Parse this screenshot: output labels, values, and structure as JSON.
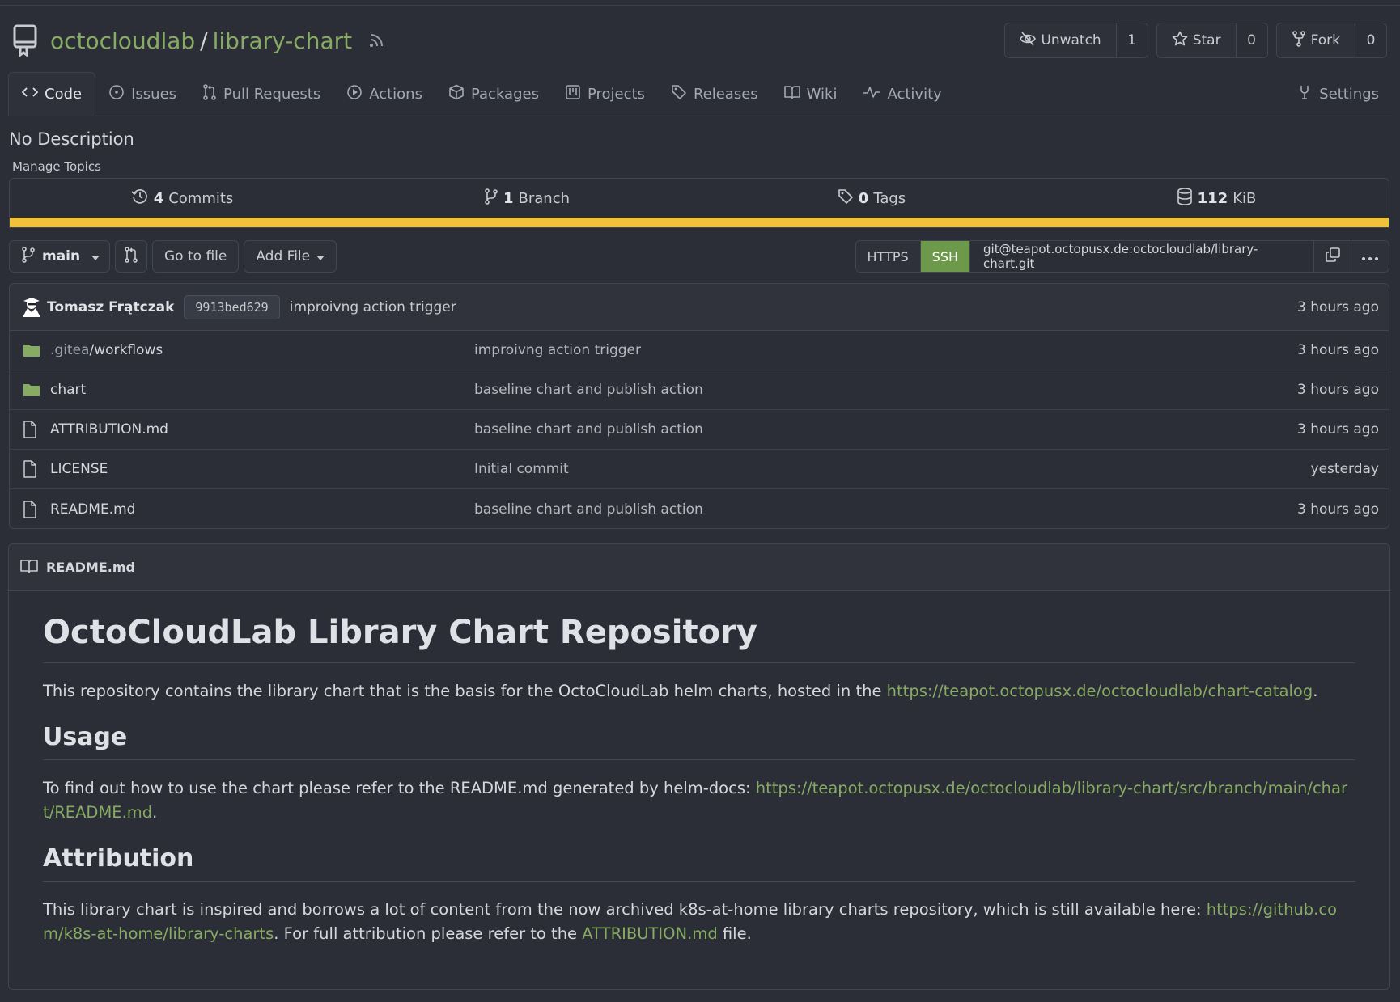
{
  "repo": {
    "owner": "octocloudlab",
    "separator": "/",
    "name": "library-chart",
    "unwatch_label": "Unwatch",
    "watch_count": "1",
    "star_label": "Star",
    "star_count": "0",
    "fork_label": "Fork",
    "fork_count": "0"
  },
  "tabs": [
    {
      "label": "Code",
      "icon": "code-icon",
      "active": true
    },
    {
      "label": "Issues",
      "icon": "issue-icon"
    },
    {
      "label": "Pull Requests",
      "icon": "pull-request-icon"
    },
    {
      "label": "Actions",
      "icon": "play-icon"
    },
    {
      "label": "Packages",
      "icon": "package-icon"
    },
    {
      "label": "Projects",
      "icon": "project-icon"
    },
    {
      "label": "Releases",
      "icon": "tag-icon"
    },
    {
      "label": "Wiki",
      "icon": "book-icon"
    },
    {
      "label": "Activity",
      "icon": "pulse-icon"
    },
    {
      "label": "Settings",
      "icon": "tools-icon"
    }
  ],
  "description": "No Description",
  "manage_topics": "Manage Topics",
  "stats": {
    "commits_count": "4",
    "commits_label": "Commits",
    "branch_count": "1",
    "branch_label": "Branch",
    "tags_count": "0",
    "tags_label": "Tags",
    "size_value": "112",
    "size_unit": "KiB"
  },
  "language_bar_color": "#f0c23a",
  "toolbar": {
    "branch": "main",
    "go_to_file": "Go to file",
    "add_file": "Add File",
    "https_label": "HTTPS",
    "ssh_label": "SSH",
    "clone_url": "git@teapot.octopusx.de:octocloudlab/library-chart.git"
  },
  "latest_commit": {
    "author": "Tomasz Frątczak",
    "sha": "9913bed629",
    "message": "improivng action trigger",
    "time": "3 hours ago"
  },
  "files": [
    {
      "name_prefix": ".gitea",
      "name": "/workflows",
      "type": "folder",
      "message": "improivng action trigger",
      "time": "3 hours ago"
    },
    {
      "name_prefix": "",
      "name": "chart",
      "type": "folder",
      "message": "baseline chart and publish action",
      "time": "3 hours ago"
    },
    {
      "name_prefix": "",
      "name": "ATTRIBUTION.md",
      "type": "file",
      "message": "baseline chart and publish action",
      "time": "3 hours ago"
    },
    {
      "name_prefix": "",
      "name": "LICENSE",
      "type": "file",
      "message": "Initial commit",
      "time": "yesterday"
    },
    {
      "name_prefix": "",
      "name": "README.md",
      "type": "file",
      "message": "baseline chart and publish action",
      "time": "3 hours ago"
    }
  ],
  "readme": {
    "filename": "README.md",
    "title": "OctoCloudLab Library Chart Repository",
    "intro_text": "This repository contains the library chart that is the basis for the OctoCloudLab helm charts, hosted in the ",
    "intro_link": "https://teapot.octopusx.de/octocloudlab/chart-catalog",
    "intro_end": ".",
    "usage_heading": "Usage",
    "usage_text": "To find out how to use the chart please refer to the README.md generated by helm-docs: ",
    "usage_link": "https://teapot.octopusx.de/octocloudlab/library-chart/src/branch/main/chart/README.md",
    "usage_end": ".",
    "attribution_heading": "Attribution",
    "attribution_text": "This library chart is inspired and borrows a lot of content from the now archived k8s-at-home library charts repository, which is still available here: ",
    "attribution_link": "https://github.com/k8s-at-home/library-charts",
    "attribution_mid": ". For full attribution please refer to the ",
    "attribution_file_link": "ATTRIBUTION.md",
    "attribution_end": " file."
  }
}
